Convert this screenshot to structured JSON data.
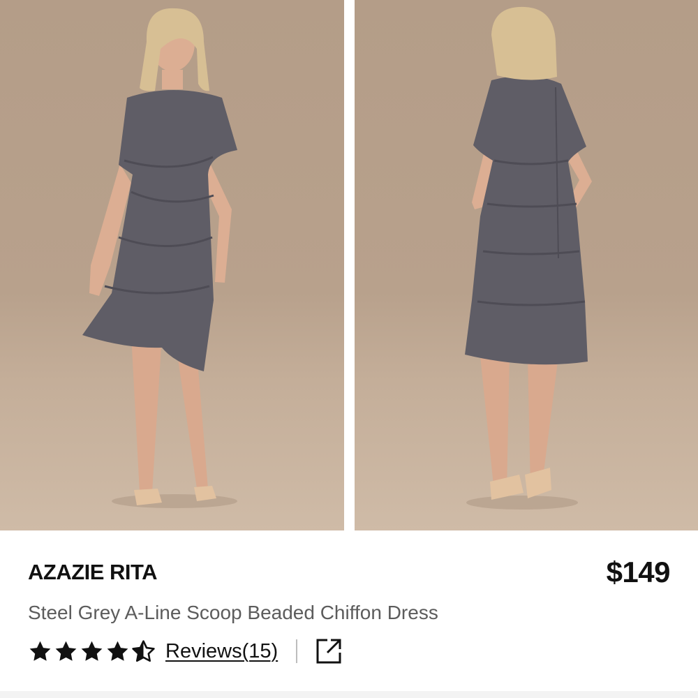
{
  "product": {
    "brand_name": "AZAZIE RITA",
    "price": "$149",
    "description": "Steel Grey A-Line Scoop Beaded Chiffon Dress",
    "rating": 4.5,
    "rating_max": 5,
    "reviews_label": "Reviews(15)"
  },
  "gallery": {
    "images": [
      {
        "alt": "Model wearing steel grey tiered chiffon dress, front view"
      },
      {
        "alt": "Model wearing steel grey tiered chiffon dress, back view"
      }
    ]
  },
  "icons": {
    "star": "star-icon",
    "share": "external-link-icon"
  },
  "colors": {
    "dress": "#5f5d66",
    "background": "#b8a18c",
    "text": "#111111",
    "subtext": "#5c5c5c"
  }
}
